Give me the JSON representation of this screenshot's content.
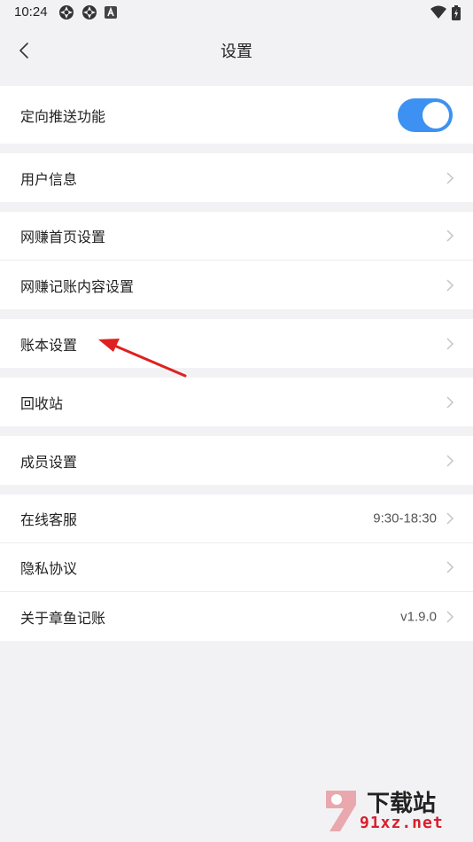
{
  "status_bar": {
    "time": "10:24",
    "icons_left": [
      "app-icon",
      "app-icon",
      "notification-icon"
    ],
    "icons_right": [
      "wifi-icon",
      "battery-icon"
    ]
  },
  "header": {
    "title": "设置",
    "back_icon": "chevron-left-icon"
  },
  "settings": {
    "push": {
      "label": "定向推送功能",
      "toggle_on": true,
      "toggle_color": "#3d91f2"
    },
    "user_info": {
      "label": "用户信息"
    },
    "home_settings": {
      "label": "网赚首页设置"
    },
    "content_settings": {
      "label": "网赚记账内容设置"
    },
    "ledger_settings": {
      "label": "账本设置"
    },
    "recycle_bin": {
      "label": "回收站"
    },
    "member_settings": {
      "label": "成员设置"
    },
    "online_service": {
      "label": "在线客服",
      "value": "9:30-18:30"
    },
    "privacy": {
      "label": "隐私协议"
    },
    "about": {
      "label": "关于章鱼记账",
      "value": "v1.9.0"
    }
  },
  "annotation": {
    "arrow_color": "#e02020"
  },
  "watermark": {
    "top": "下载站",
    "bottom": "91xz.net"
  }
}
